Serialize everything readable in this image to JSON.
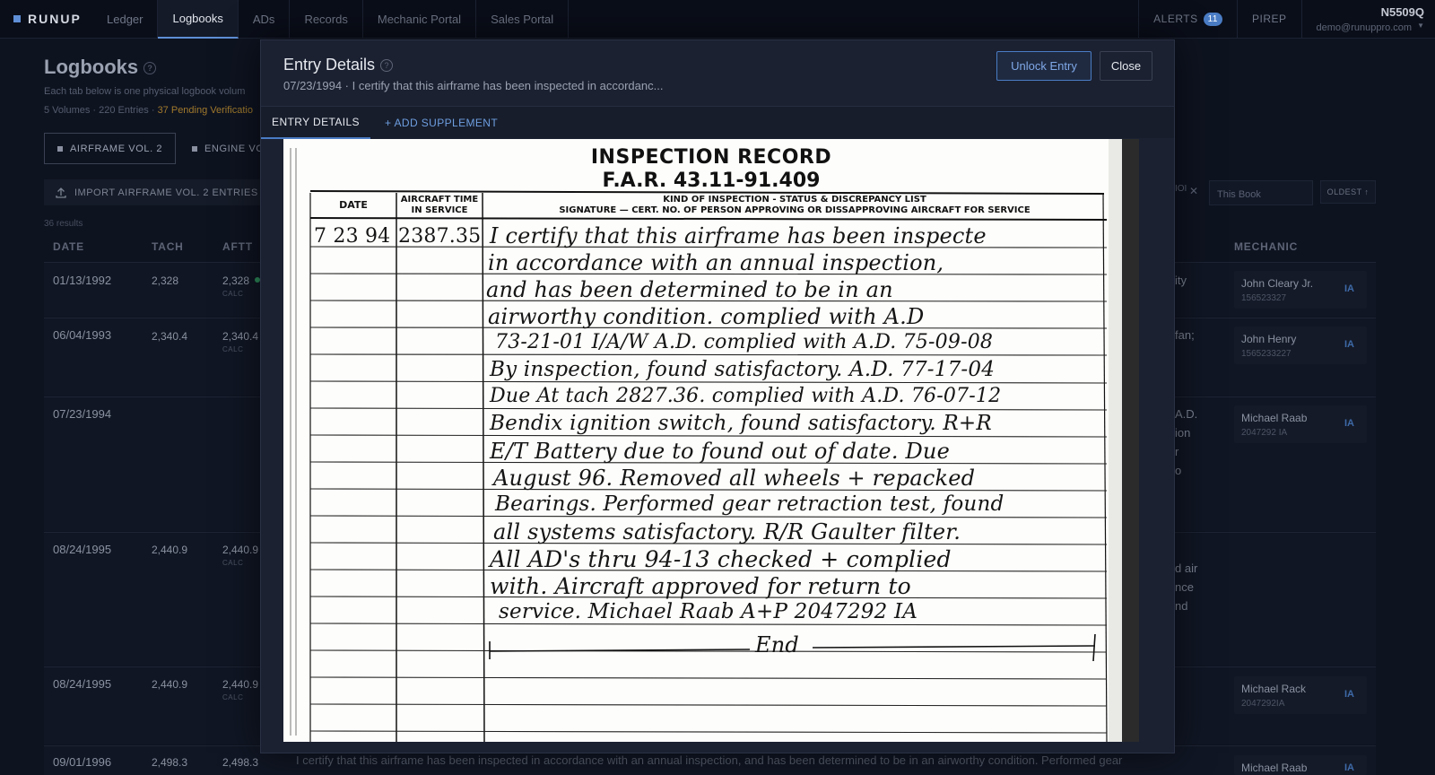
{
  "nav": {
    "logo": "RUNUP",
    "tabs": [
      "Ledger",
      "Logbooks",
      "ADs",
      "Records",
      "Mechanic Portal",
      "Sales Portal"
    ],
    "alerts_label": "ALERTS",
    "alerts_count": "11",
    "pirep": "PIREP",
    "tail": "N5509Q",
    "email": "demo@runuppro.com"
  },
  "page": {
    "title": "Logbooks",
    "subtitle": "Each tab below is one physical logbook volum",
    "stats_prefix": "5 Volumes · 220 Entries · ",
    "stats_pending": "37 Pending Verificatio",
    "volume_tabs": [
      "AIRFRAME VOL. 2",
      "ENGINE VO"
    ],
    "import_label": "IMPORT AIRFRAME VOL. 2 ENTRIES",
    "results": "36 results",
    "filter_clip": "IOI",
    "filter_value": "This Book",
    "sort_label": "OLDEST ↑",
    "columns": {
      "date": "DATE",
      "tach": "TACH",
      "aftt": "AFTT",
      "mechanic": "MECHANIC"
    },
    "rows": [
      {
        "date": "01/13/1992",
        "tach": "2,328",
        "aftt": "2,328",
        "calc": "CALC",
        "frag": [
          "ity"
        ],
        "mech": "John Cleary Jr.",
        "cert": "156523327",
        "ia": "IA"
      },
      {
        "date": "06/04/1993",
        "tach": "2,340.4",
        "aftt": "2,340.4",
        "calc": "CALC",
        "frag": [
          "fan;"
        ],
        "mech": "John Henry",
        "cert": "1565233227",
        "ia": "IA"
      },
      {
        "date": "07/23/1994",
        "tach": "",
        "aftt": "",
        "calc": "",
        "frag": [
          "A.D.",
          "ion",
          "r",
          "o"
        ],
        "mech": "Michael Raab",
        "cert": "2047292 IA",
        "ia": "IA"
      },
      {
        "date": "08/24/1995",
        "tach": "2,440.9",
        "aftt": "2,440.9",
        "calc": "CALC",
        "frag": [
          "d air",
          "nce",
          "nd"
        ],
        "mech": "",
        "cert": "",
        "ia": ""
      },
      {
        "date": "08/24/1995",
        "tach": "2,440.9",
        "aftt": "2,440.9",
        "calc": "CALC",
        "frag": [],
        "mech": "Michael Rack",
        "cert": "2047292IA",
        "ia": "IA"
      },
      {
        "date": "09/01/1996",
        "tach": "2,498.3",
        "aftt": "2,498.3",
        "calc": "CALC",
        "frag": [],
        "mech": "Michael Raab",
        "cert": "",
        "ia": "IA"
      }
    ],
    "bottom_text": "I certify that this airframe has been inspected in accordance with an annual inspection, and has been determined to be in an airworthy condition. Performed gear"
  },
  "modal": {
    "title": "Entry Details",
    "subtitle": "07/23/1994 · I certify that this airframe has been inspected in accordanc...",
    "unlock_label": "Unlock Entry",
    "close_label": "Close",
    "tab_details": "ENTRY DETAILS",
    "tab_add": "+ ADD SUPPLEMENT"
  },
  "scan": {
    "title": "INSPECTION RECORD",
    "far": "F.A.R. 43.11-91.409",
    "header_date": "DATE",
    "header_time_1": "AIRCRAFT TIME",
    "header_time_2": "IN SERVICE",
    "header_kind_1": "KIND OF INSPECTION - STATUS & DISCREPANCY LIST",
    "header_kind_2": "SIGNATURE — CERT. NO. OF PERSON APPROVING OR DISSAPPROVING AIRCRAFT FOR SERVICE",
    "entry_date": "7 23 94",
    "entry_time": "2387.35",
    "lines": [
      "I certify that this airframe has been inspecte",
      "in accordance with an annual inspection,",
      "and has been determined to be in an",
      "airworthy condition. complied with A.D",
      "73-21-01 I/A/W A.D. complied with A.D. 75-09-08",
      "By inspection, found satisfactory. A.D. 77-17-04",
      "Due At tach 2827.36. complied with A.D. 76-07-12",
      "Bendix ignition switch, found satisfactory. R+R",
      "E/T Battery due to found out of date. Due",
      "August 96. Removed all wheels + repacked",
      "Bearings. Performed gear retraction test, found",
      "all systems satisfactory. R/R Gaulter filter.",
      "All AD's thru 94-13 checked + complied",
      "with. Aircraft approved for return to",
      "service. Michael Raab A+P 2047292 IA",
      "End"
    ]
  }
}
